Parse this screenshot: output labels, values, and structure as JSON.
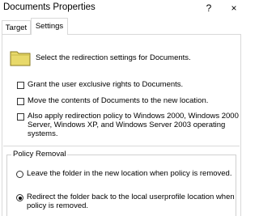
{
  "window": {
    "title": "Documents Properties",
    "help_glyph": "?",
    "close_glyph": "×"
  },
  "tabs": [
    {
      "label": "Target",
      "selected": false
    },
    {
      "label": "Settings",
      "selected": true
    }
  ],
  "settings": {
    "description": "Select the redirection settings for Documents.",
    "folder_icon": "folder-icon",
    "options": [
      {
        "label_lines": [
          "Grant the user exclusive rights to Documents."
        ],
        "checked": false
      },
      {
        "label_lines": [
          "Move the contents of Documents to the new location."
        ],
        "checked": false
      },
      {
        "label_lines": [
          "Also apply redirection policy to Windows 2000, Windows 2000",
          "Server, Windows XP, and Windows Server 2003 operating",
          "systems."
        ],
        "checked": false
      }
    ],
    "policy_removal": {
      "title": "Policy Removal",
      "options": [
        {
          "label_lines": [
            "Leave the folder in the new location when policy is removed."
          ],
          "selected": false
        },
        {
          "label_lines": [
            "Redirect the folder back to the local userprofile location when",
            "policy is removed."
          ],
          "selected": true
        }
      ]
    }
  },
  "colors": {
    "folder_fill": "#e8d96a",
    "folder_stroke": "#8a7a20",
    "border": "#d9d9d9"
  }
}
